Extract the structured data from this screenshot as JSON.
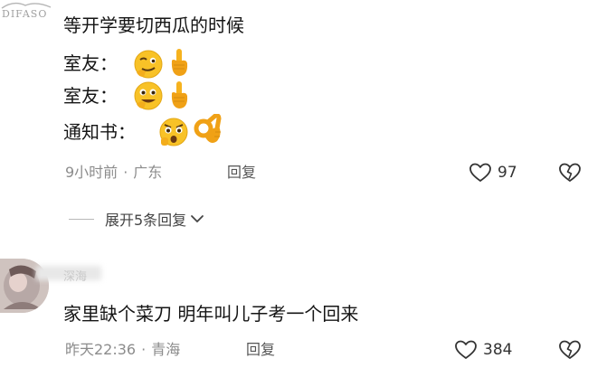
{
  "watermark": {
    "text": "DIFASO"
  },
  "comment1": {
    "lines": [
      {
        "text": "等开学要切西瓜的时候",
        "emojis": []
      },
      {
        "text": "室友：",
        "emojis": [
          "smirk-face",
          "pointing-up-hand"
        ]
      },
      {
        "text": "室友：",
        "emojis": [
          "grinning-face",
          "pointing-up-hand"
        ]
      },
      {
        "text": "通知书：",
        "emojis": [
          "shocked-face",
          "ok-hand"
        ]
      }
    ],
    "time": "9小时前",
    "separator": "·",
    "location": "广东",
    "reply_label": "回复",
    "like_count": "97",
    "expand_label": "展开5条回复"
  },
  "comment2": {
    "username": "深海",
    "text": "家里缺个菜刀  明年叫儿子考一个回来",
    "time": "昨天22:36",
    "separator": "·",
    "location": "青海",
    "reply_label": "回复",
    "like_count": "384"
  },
  "colors": {
    "text_primary": "#151515",
    "text_meta": "#8c8c8c",
    "emoji_yellow": "#f8c227",
    "emoji_orange": "#e89a1c",
    "divider": "#b8b8b8"
  }
}
